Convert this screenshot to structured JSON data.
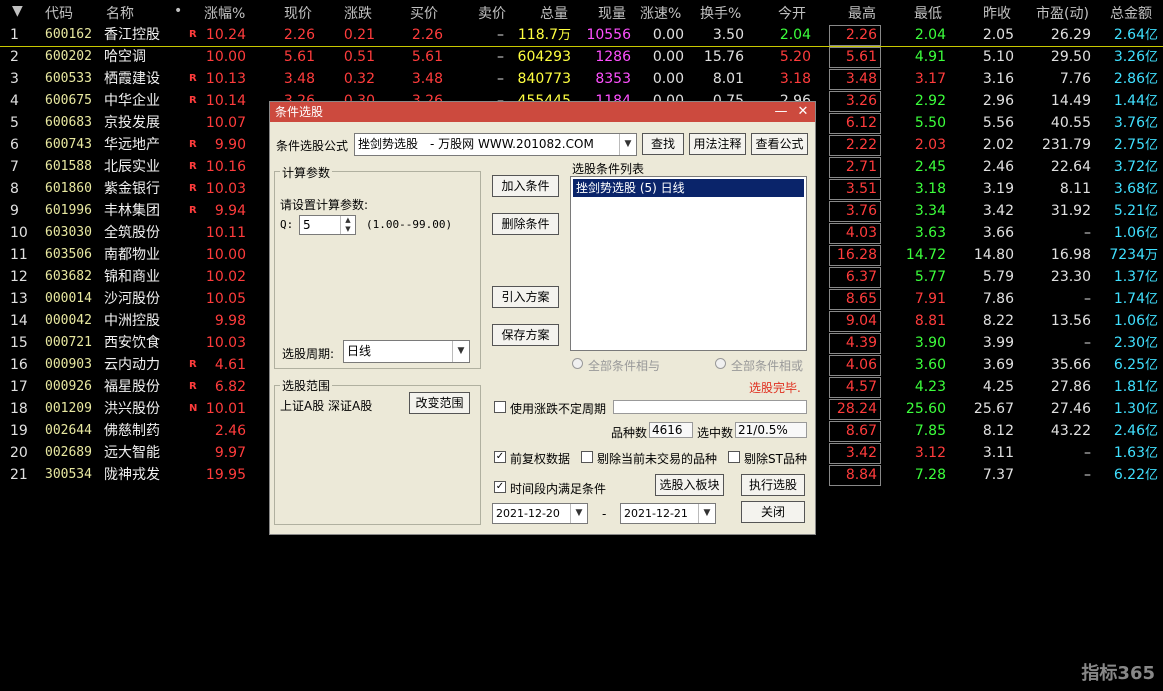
{
  "header": {
    "arrow": "▼",
    "code": "代码",
    "name": "名称",
    "dot": "•",
    "change_pct": "涨幅%",
    "price": "现价",
    "change": "涨跌",
    "bid": "买价",
    "ask": "卖价",
    "volume": "总量",
    "cur_vol": "现量",
    "speed": "涨速%",
    "turnover": "换手%",
    "open": "今开",
    "high": "最高",
    "low": "最低",
    "prev_close": "昨收",
    "pe": "市盈(动)",
    "amount": "总金额"
  },
  "rows": [
    {
      "idx": "1",
      "code": "600162",
      "name": "香江控股",
      "flag": "R",
      "pct": "10.24",
      "price": "2.26",
      "chg": "0.21",
      "bid": "2.26",
      "ask": "–",
      "vol": "118.7",
      "vol_unit": "万",
      "cur": "10556",
      "speed": "0.00",
      "turn": "3.50",
      "open": "2.04",
      "high": "2.26",
      "low": "2.04",
      "prev": "2.05",
      "pe": "26.29",
      "amt": "2.64",
      "amt_unit": "亿"
    },
    {
      "idx": "2",
      "code": "600202",
      "name": "哈空调",
      "flag": "",
      "pct": "10.00",
      "price": "5.61",
      "chg": "0.51",
      "bid": "5.61",
      "ask": "–",
      "vol": "604293",
      "vol_unit": "",
      "cur": "1286",
      "speed": "0.00",
      "turn": "15.76",
      "open": "5.20",
      "high": "5.61",
      "low": "4.91",
      "prev": "5.10",
      "pe": "29.50",
      "amt": "3.26",
      "amt_unit": "亿"
    },
    {
      "idx": "3",
      "code": "600533",
      "name": "栖霞建设",
      "flag": "R",
      "pct": "10.13",
      "price": "3.48",
      "chg": "0.32",
      "bid": "3.48",
      "ask": "–",
      "vol": "840773",
      "vol_unit": "",
      "cur": "8353",
      "speed": "0.00",
      "turn": "8.01",
      "open": "3.18",
      "high": "3.48",
      "low": "3.17",
      "prev": "3.16",
      "pe": "7.76",
      "amt": "2.86",
      "amt_unit": "亿"
    },
    {
      "idx": "4",
      "code": "600675",
      "name": "中华企业",
      "flag": "R",
      "pct": "10.14",
      "price": "3.26",
      "chg": "0.30",
      "bid": "3.26",
      "ask": "–",
      "vol": "455445",
      "vol_unit": "",
      "cur": "1184",
      "speed": "0.00",
      "turn": "0.75",
      "open": "2.96",
      "high": "3.26",
      "low": "2.92",
      "prev": "2.96",
      "pe": "14.49",
      "amt": "1.44",
      "amt_unit": "亿"
    },
    {
      "idx": "5",
      "code": "600683",
      "name": "京投发展",
      "flag": "",
      "pct": "10.07",
      "price": "",
      "chg": "",
      "bid": "",
      "ask": "",
      "vol": "",
      "vol_unit": "",
      "cur": "",
      "speed": "",
      "turn": "",
      "open": "",
      "high": "6.12",
      "low": "5.50",
      "prev": "5.56",
      "pe": "40.55",
      "amt": "3.76",
      "amt_unit": "亿"
    },
    {
      "idx": "6",
      "code": "600743",
      "name": "华远地产",
      "flag": "R",
      "pct": "9.90",
      "price": "",
      "chg": "",
      "bid": "",
      "ask": "",
      "vol": "",
      "vol_unit": "",
      "cur": "",
      "speed": "",
      "turn": "",
      "open": "",
      "high": "2.22",
      "low": "2.03",
      "prev": "2.02",
      "pe": "231.79",
      "amt": "2.75",
      "amt_unit": "亿"
    },
    {
      "idx": "7",
      "code": "601588",
      "name": "北辰实业",
      "flag": "R",
      "pct": "10.16",
      "price": "",
      "chg": "",
      "bid": "",
      "ask": "",
      "vol": "",
      "vol_unit": "",
      "cur": "",
      "speed": "",
      "turn": "",
      "open": "",
      "high": "2.71",
      "low": "2.45",
      "prev": "2.46",
      "pe": "22.64",
      "amt": "3.72",
      "amt_unit": "亿"
    },
    {
      "idx": "8",
      "code": "601860",
      "name": "紫金银行",
      "flag": "R",
      "pct": "10.03",
      "price": "",
      "chg": "",
      "bid": "",
      "ask": "",
      "vol": "",
      "vol_unit": "",
      "cur": "",
      "speed": "",
      "turn": "",
      "open": "",
      "high": "3.51",
      "low": "3.18",
      "prev": "3.19",
      "pe": "8.11",
      "amt": "3.68",
      "amt_unit": "亿"
    },
    {
      "idx": "9",
      "code": "601996",
      "name": "丰林集团",
      "flag": "R",
      "pct": "9.94",
      "price": "",
      "chg": "",
      "bid": "",
      "ask": "",
      "vol": "",
      "vol_unit": "",
      "cur": "",
      "speed": "",
      "turn": "",
      "open": "",
      "high": "3.76",
      "low": "3.34",
      "prev": "3.42",
      "pe": "31.92",
      "amt": "5.21",
      "amt_unit": "亿"
    },
    {
      "idx": "10",
      "code": "603030",
      "name": "全筑股份",
      "flag": "",
      "pct": "10.11",
      "price": "",
      "chg": "",
      "bid": "",
      "ask": "",
      "vol": "",
      "vol_unit": "",
      "cur": "",
      "speed": "",
      "turn": "",
      "open": "",
      "high": "4.03",
      "low": "3.63",
      "prev": "3.66",
      "pe": "–",
      "amt": "1.06",
      "amt_unit": "亿"
    },
    {
      "idx": "11",
      "code": "603506",
      "name": "南都物业",
      "flag": "",
      "pct": "10.00",
      "price": "",
      "chg": "",
      "bid": "",
      "ask": "",
      "vol": "",
      "vol_unit": "",
      "cur": "",
      "speed": "",
      "turn": "",
      "open": "",
      "high": "16.28",
      "low": "14.72",
      "prev": "14.80",
      "pe": "16.98",
      "amt": "7234",
      "amt_unit": "万"
    },
    {
      "idx": "12",
      "code": "603682",
      "name": "锦和商业",
      "flag": "",
      "pct": "10.02",
      "price": "",
      "chg": "",
      "bid": "",
      "ask": "",
      "vol": "",
      "vol_unit": "",
      "cur": "",
      "speed": "",
      "turn": "",
      "open": "",
      "high": "6.37",
      "low": "5.77",
      "prev": "5.79",
      "pe": "23.30",
      "amt": "1.37",
      "amt_unit": "亿"
    },
    {
      "idx": "13",
      "code": "000014",
      "name": "沙河股份",
      "flag": "",
      "pct": "10.05",
      "price": "",
      "chg": "",
      "bid": "",
      "ask": "",
      "vol": "",
      "vol_unit": "",
      "cur": "",
      "speed": "",
      "turn": "",
      "open": "",
      "high": "8.65",
      "low": "7.91",
      "prev": "7.86",
      "pe": "–",
      "amt": "1.74",
      "amt_unit": "亿"
    },
    {
      "idx": "14",
      "code": "000042",
      "name": "中洲控股",
      "flag": "",
      "pct": "9.98",
      "price": "",
      "chg": "",
      "bid": "",
      "ask": "",
      "vol": "",
      "vol_unit": "",
      "cur": "",
      "speed": "",
      "turn": "",
      "open": "",
      "high": "9.04",
      "low": "8.81",
      "prev": "8.22",
      "pe": "13.56",
      "amt": "1.06",
      "amt_unit": "亿"
    },
    {
      "idx": "15",
      "code": "000721",
      "name": "西安饮食",
      "flag": "",
      "pct": "10.03",
      "price": "",
      "chg": "",
      "bid": "",
      "ask": "",
      "vol": "",
      "vol_unit": "",
      "cur": "",
      "speed": "",
      "turn": "",
      "open": "",
      "high": "4.39",
      "low": "3.90",
      "prev": "3.99",
      "pe": "–",
      "amt": "2.30",
      "amt_unit": "亿"
    },
    {
      "idx": "16",
      "code": "000903",
      "name": "云内动力",
      "flag": "R",
      "pct": "4.61",
      "price": "",
      "chg": "",
      "bid": "",
      "ask": "",
      "vol": "",
      "vol_unit": "",
      "cur": "",
      "speed": "",
      "turn": "",
      "open": "",
      "high": "4.06",
      "low": "3.60",
      "prev": "3.69",
      "pe": "35.66",
      "amt": "6.25",
      "amt_unit": "亿"
    },
    {
      "idx": "17",
      "code": "000926",
      "name": "福星股份",
      "flag": "R",
      "pct": "6.82",
      "price": "",
      "chg": "",
      "bid": "",
      "ask": "",
      "vol": "",
      "vol_unit": "",
      "cur": "",
      "speed": "",
      "turn": "",
      "open": "",
      "high": "4.57",
      "low": "4.23",
      "prev": "4.25",
      "pe": "27.86",
      "amt": "1.81",
      "amt_unit": "亿"
    },
    {
      "idx": "18",
      "code": "001209",
      "name": "洪兴股份",
      "flag": "N",
      "pct": "10.01",
      "price": "",
      "chg": "",
      "bid": "",
      "ask": "",
      "vol": "",
      "vol_unit": "",
      "cur": "",
      "speed": "",
      "turn": "",
      "open": "",
      "high": "28.24",
      "low": "25.60",
      "prev": "25.67",
      "pe": "27.46",
      "amt": "1.30",
      "amt_unit": "亿"
    },
    {
      "idx": "19",
      "code": "002644",
      "name": "佛慈制药",
      "flag": "",
      "pct": "2.46",
      "price": "",
      "chg": "",
      "bid": "",
      "ask": "",
      "vol": "",
      "vol_unit": "",
      "cur": "",
      "speed": "",
      "turn": "",
      "open": "",
      "high": "8.67",
      "low": "7.85",
      "prev": "8.12",
      "pe": "43.22",
      "amt": "2.46",
      "amt_unit": "亿"
    },
    {
      "idx": "20",
      "code": "002689",
      "name": "远大智能",
      "flag": "",
      "pct": "9.97",
      "price": "",
      "chg": "",
      "bid": "",
      "ask": "",
      "vol": "",
      "vol_unit": "",
      "cur": "",
      "speed": "",
      "turn": "",
      "open": "",
      "high": "3.42",
      "low": "3.12",
      "prev": "3.11",
      "pe": "–",
      "amt": "1.63",
      "amt_unit": "亿"
    },
    {
      "idx": "21",
      "code": "300534",
      "name": "陇神戎发",
      "flag": "",
      "pct": "19.95",
      "price": "",
      "chg": "",
      "bid": "",
      "ask": "",
      "vol": "",
      "vol_unit": "",
      "cur": "",
      "speed": "",
      "turn": "",
      "open": "",
      "high": "8.84",
      "low": "7.28",
      "prev": "7.37",
      "pe": "–",
      "amt": "6.22",
      "amt_unit": "亿"
    }
  ],
  "dialog": {
    "title": "条件选股",
    "minimize": "—",
    "close": "✕",
    "formula_label": "条件选股公式",
    "formula_value": "挫剑势选股　- 万股网 WWW.201082.COM",
    "find_btn": "查找",
    "usage_btn": "用法注释",
    "view_btn": "查看公式",
    "params_group": "计算参数",
    "params_prompt": "请设置计算参数:",
    "param_name": "Q:",
    "param_value": "5",
    "param_range": "(1.00--99.00)",
    "period_label": "选股周期:",
    "period_value": "日线",
    "add_btn": "加入条件",
    "del_btn": "删除条件",
    "import_btn": "引入方案",
    "save_btn": "保存方案",
    "list_label": "选股条件列表",
    "list_items": [
      "挫剑势选股 (5) 日线"
    ],
    "and_label": "全部条件相与",
    "or_label": "全部条件相或",
    "status": "选股完毕.",
    "range_group": "选股范围",
    "range_value": "上证A股 深证A股",
    "change_range_btn": "改变范围",
    "use_limit_label": "使用涨跌不定周期",
    "count_label": "品种数",
    "count_value": "4616",
    "selected_label": "选中数",
    "selected_value": "21/0.5%",
    "adjusted_label": "前复权数据",
    "exclude_notrade_label": "剔除当前未交易的品种",
    "exclude_st_label": "剔除ST品种",
    "time_cond_label": "时间段内满足条件",
    "to_block_btn": "选股入板块",
    "execute_btn": "执行选股",
    "date_from": "2021-12-20",
    "date_sep": "-",
    "date_to": "2021-12-21",
    "close_btn": "关闭",
    "check_mark": "✓"
  },
  "logo": "指标365"
}
